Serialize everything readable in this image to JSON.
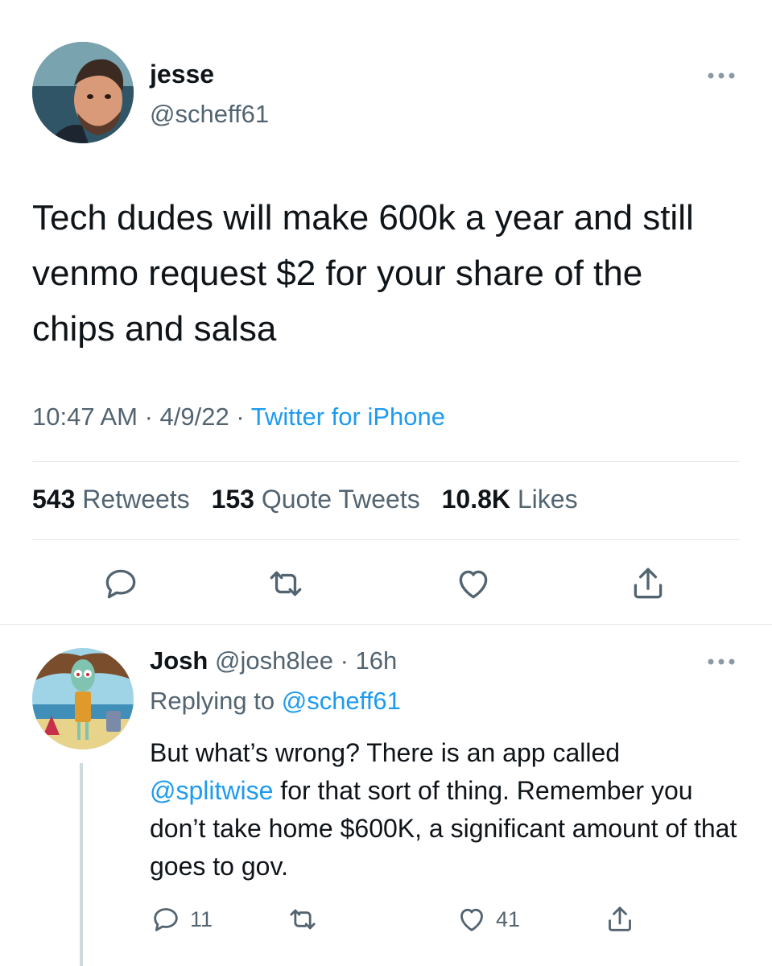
{
  "tweet": {
    "author_name": "jesse",
    "author_handle": "@scheff61",
    "text": "Tech dudes will make 600k a year and still venmo request $2 for your share of the chips and salsa",
    "time": "10:47 AM",
    "date": "4/9/22",
    "source": "Twitter for iPhone",
    "stats": {
      "retweets_count": "543",
      "retweets_label": "Retweets",
      "quotes_count": "153",
      "quotes_label": "Quote Tweets",
      "likes_count": "10.8K",
      "likes_label": "Likes"
    }
  },
  "reply": {
    "author_name": "Josh",
    "author_handle": "@josh8lee",
    "age": "16h",
    "replying_prefix": "Replying to",
    "replying_handle": "@scheff61",
    "text_part1": "But what’s wrong? There is an app called ",
    "mention": "@splitwise",
    "text_part2": " for that sort of thing. Remember you don’t take home $600K, a significant amount of that goes to gov.",
    "reply_count": "11",
    "like_count": "41"
  },
  "icons": {
    "more": "more-horizontal-icon",
    "reply": "reply-bubble-icon",
    "retweet": "retweet-icon",
    "like": "heart-icon",
    "share": "share-icon"
  },
  "colors": {
    "accent": "#1d9bf0",
    "secondary_text": "#536471",
    "primary_text": "#0f1419"
  }
}
